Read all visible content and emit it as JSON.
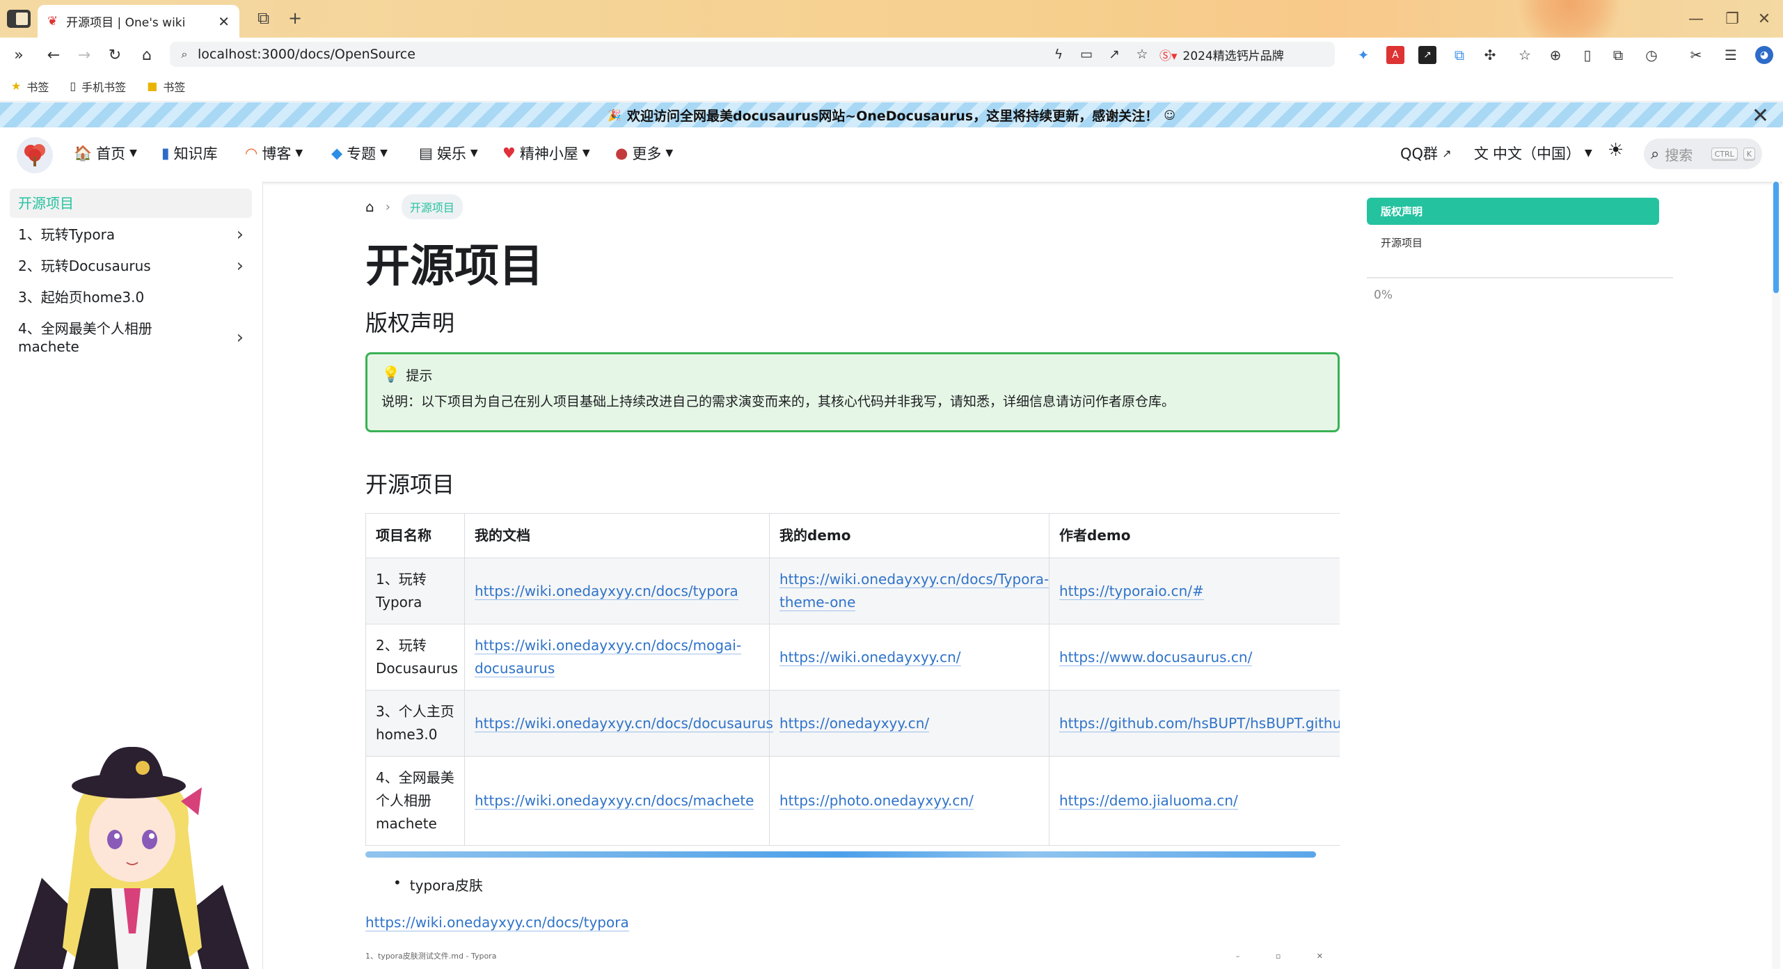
{
  "browser": {
    "tab_title": "开源项目 | One's wiki",
    "url": "localhost:3000/docs/OpenSource",
    "promo_text": "2024精选钙片品牌",
    "bookmarks": [
      "书签",
      "手机书签",
      "书签"
    ]
  },
  "announcement": {
    "text": "欢迎访问全网最美docusaurus网站~OneDocusaurus，这里将持续更新，感谢关注！"
  },
  "navbar": {
    "items": [
      "首页",
      "知识库",
      "博客",
      "专题",
      "娱乐",
      "精神小屋",
      "更多"
    ],
    "qq": "QQ群",
    "language": "中文（中国）",
    "search_placeholder": "搜索",
    "kbd_ctrl": "CTRL",
    "kbd_k": "K"
  },
  "sidebar": {
    "items": [
      {
        "label": "开源项目"
      },
      {
        "label": "1、玩转Typora"
      },
      {
        "label": "2、玩转Docusaurus"
      },
      {
        "label": "3、起始页home3.0"
      },
      {
        "label": "4、全网最美个人相册machete"
      }
    ]
  },
  "content": {
    "breadcrumb": "开源项目",
    "title": "开源项目",
    "section1": "版权声明",
    "admonition_title": "提示",
    "admonition_body": "说明：以下项目为自己在别人项目基础上持续改进自己的需求演变而来的，其核心代码并非我写，请知悉，详细信息请访问作者原仓库。",
    "section2": "开源项目",
    "table": {
      "headers": [
        "项目名称",
        "我的文档",
        "我的demo",
        "作者demo"
      ],
      "rows": [
        [
          "1、玩转Typora",
          "https://wiki.onedayxyy.cn/docs/typora",
          "https://wiki.onedayxyy.cn/docs/Typora-theme-one",
          "https://typoraio.cn/#"
        ],
        [
          "2、玩转Docusaurus",
          "https://wiki.onedayxyy.cn/docs/mogai-docusaurus",
          "https://wiki.onedayxyy.cn/",
          "https://www.docusaurus.cn/"
        ],
        [
          "3、个人主页home3.0",
          "https://wiki.onedayxyy.cn/docs/docusaurus",
          "https://onedayxyy.cn/",
          "https://github.com/hsBUPT/hsBUPT.github"
        ],
        [
          "4、全网最美个人相册machete",
          "https://wiki.onedayxyy.cn/docs/machete",
          "https://photo.onedayxyy.cn/",
          "https://demo.jialuoma.cn/"
        ]
      ]
    },
    "bullet": "typora皮肤",
    "link_below": "https://wiki.onedayxyy.cn/docs/typora",
    "typora_strip": "1、typora皮肤测试文件.md - Typora"
  },
  "toc": {
    "items": [
      "版权声明",
      "开源项目"
    ],
    "progress": "0%"
  },
  "colors": {
    "accent": "#25c2a0",
    "link": "#2f73c9",
    "tip_border": "#3ab155"
  }
}
